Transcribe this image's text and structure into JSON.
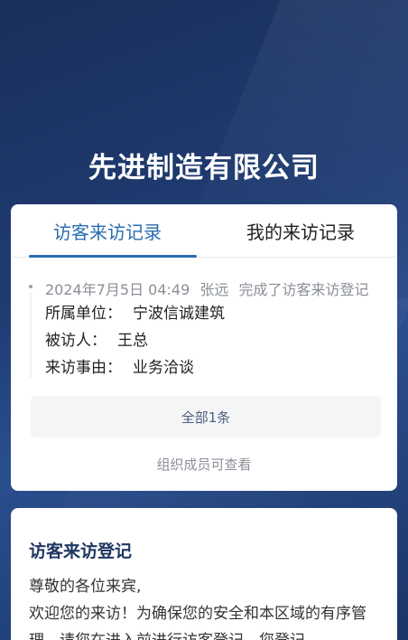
{
  "company": {
    "name": "先进制造有限公司"
  },
  "tabs": [
    {
      "label": "访客来访记录",
      "active": true
    },
    {
      "label": "我的来访记录",
      "active": false
    }
  ],
  "record": {
    "datetime": "2024年7月5日 04:49",
    "person": "张远",
    "action": "完成了访客来访登记",
    "fields": [
      {
        "key": "所属单位：",
        "value": "宁波信诚建筑"
      },
      {
        "key": "被访人：",
        "value": "王总"
      },
      {
        "key": "来访事由：",
        "value": "业务洽谈"
      }
    ]
  },
  "all_button": {
    "label": "全部1条"
  },
  "note": "组织成员可查看",
  "register": {
    "title": "访客来访登记",
    "greeting": "尊敬的各位来宾,",
    "paragraph": "欢迎您的来访！为确保您的安全和本区域的有序管理，请您在进入前进行访客登记，您登记"
  }
}
